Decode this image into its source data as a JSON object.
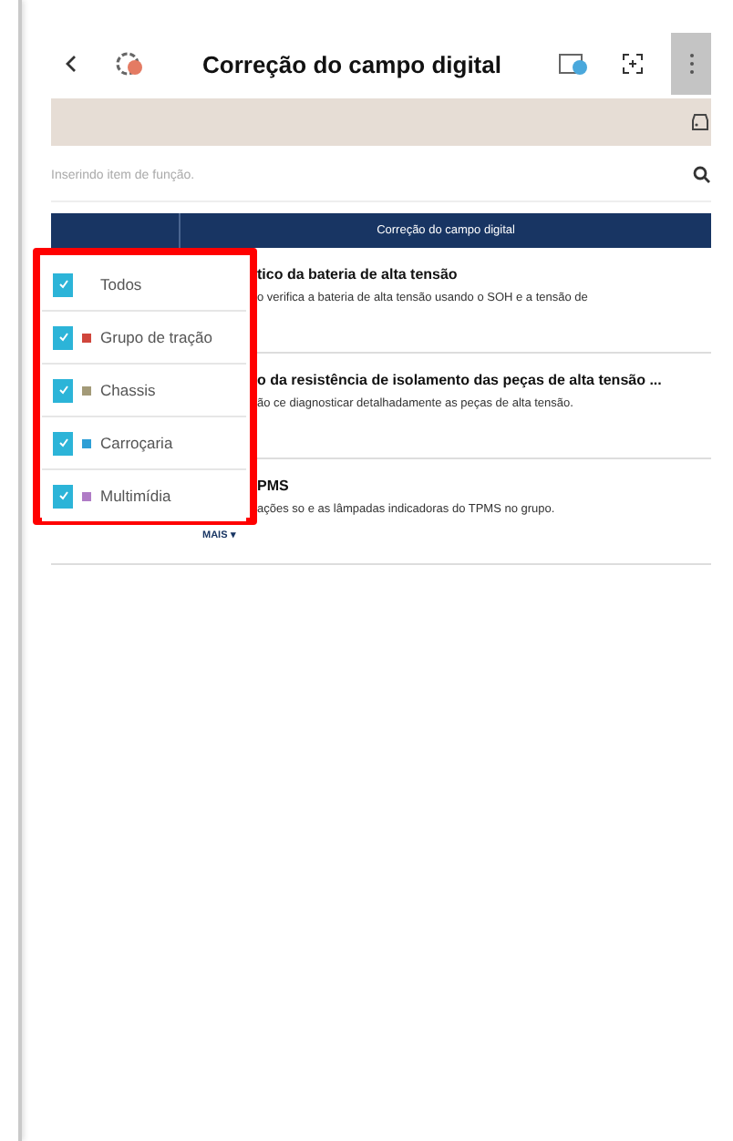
{
  "header": {
    "title": "Correção do campo digital"
  },
  "search": {
    "placeholder": "Inserindo item de função."
  },
  "table": {
    "column_header": "Correção do campo digital"
  },
  "rows": [
    {
      "title": "tico da bateria de alta tensão",
      "description": "o verifica a bateria de alta tensão usando o SOH e a tensão de"
    },
    {
      "title": "o da resistência de isolamento das peças de alta tensão ...",
      "description": "ão ce diagnosticar detalhadamente as peças de alta tensão."
    },
    {
      "title": "PMS",
      "description": "ações so e as lâmpadas indicadoras do TPMS no grupo."
    }
  ],
  "more_link": "MAIS ▾",
  "filter_menu": [
    {
      "label": "Todos",
      "checked": true
    },
    {
      "label": "Grupo de tração",
      "checked": true,
      "color": "#d0463c"
    },
    {
      "label": "Chassis",
      "checked": true,
      "color": "#a39a78"
    },
    {
      "label": "Carroçaria",
      "checked": true,
      "color": "#2e9fd6"
    },
    {
      "label": "Multimídia",
      "checked": true,
      "color": "#b07cc6"
    }
  ]
}
